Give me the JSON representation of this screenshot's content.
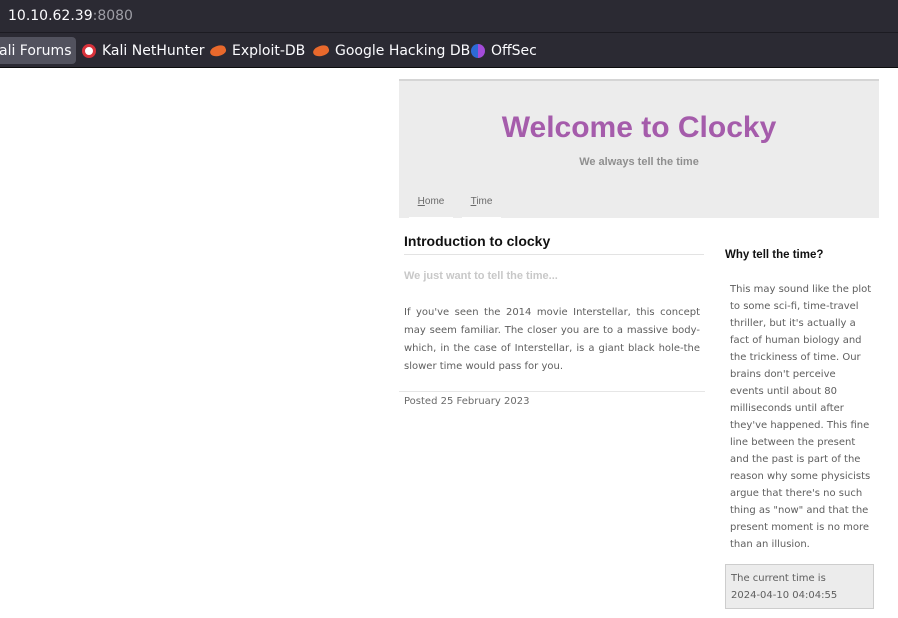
{
  "browser": {
    "url_host": "10.10.62.39",
    "url_port": ":8080",
    "bookmarks": [
      {
        "label": "ali Forums",
        "icon": "none"
      },
      {
        "label": "Kali NetHunter",
        "icon": "kali-nethunter-icon"
      },
      {
        "label": "Exploit-DB",
        "icon": "exploit-db-icon"
      },
      {
        "label": "Google Hacking DB",
        "icon": "exploit-db-icon"
      },
      {
        "label": "OffSec",
        "icon": "offsec-icon"
      }
    ]
  },
  "site": {
    "title": "Welcome to Clocky",
    "tagline": "We always tell the time",
    "nav": [
      {
        "label": "Home",
        "accesskey": "H",
        "rest": "ome"
      },
      {
        "label": "Time",
        "accesskey": "T",
        "rest": "ime"
      }
    ]
  },
  "main": {
    "heading": "Introduction to clocky",
    "lead": "We just want to tell the time...",
    "body": "If you've seen the 2014 movie Interstellar, this concept may seem familiar. The closer you are to a massive body-which, in the case of Interstellar, is a giant black hole-the slower time would pass for you.",
    "posted": "Posted 25 February 2023"
  },
  "sidebar": {
    "heading": "Why tell the time?",
    "body_lines": [
      "This may sound like the plot",
      "to some sci-fi, time-travel",
      "thriller, but it's actually a",
      "fact of human biology and",
      "the trickiness of time. Our",
      "brains don't perceive",
      "events until about 80",
      "milliseconds until after",
      "they've happened. This fine",
      "line between the present",
      "and the past is part of the",
      "reason why some physicists",
      "argue that there's no such",
      "thing as \"now\" and that the",
      "present moment is no more",
      "than an illusion."
    ],
    "time_label": "The current time is",
    "time_value": "2024-04-10 04:04:55"
  },
  "colors": {
    "chrome_bg": "#2b2a33",
    "title_purple": "#a55cab",
    "header_bg": "#ececec"
  }
}
